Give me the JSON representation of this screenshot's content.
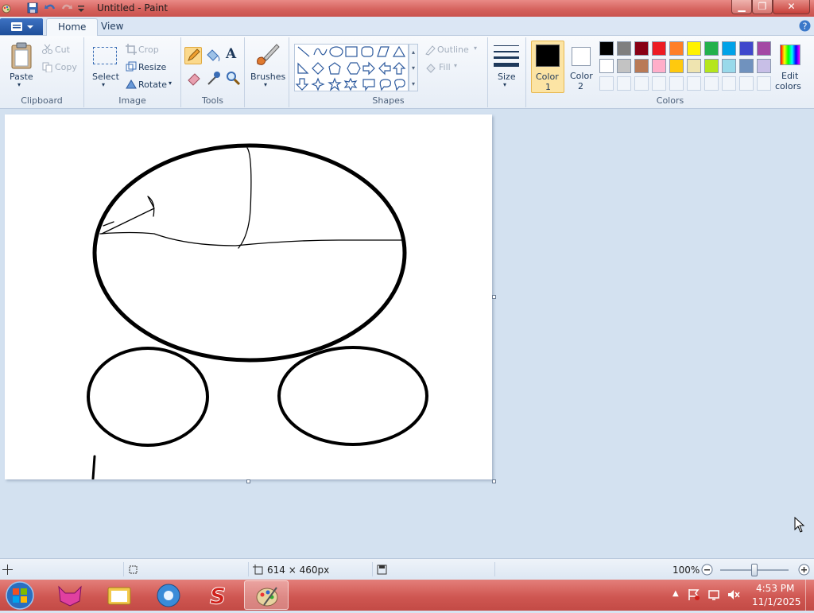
{
  "window": {
    "title": "Untitled - Paint"
  },
  "tabs": [
    {
      "label": "Home",
      "active": true
    },
    {
      "label": "View",
      "active": false
    }
  ],
  "clipboard": {
    "paste": "Paste",
    "cut": "Cut",
    "copy": "Copy",
    "group": "Clipboard"
  },
  "image": {
    "select": "Select",
    "crop": "Crop",
    "resize": "Resize",
    "rotate": "Rotate",
    "group": "Image"
  },
  "tools": {
    "group": "Tools",
    "brushes": "Brushes",
    "text_tool": "A"
  },
  "shapes": {
    "group": "Shapes",
    "outline": "Outline",
    "fill": "Fill"
  },
  "size": {
    "label": "Size"
  },
  "colors": {
    "color1_line1": "Color",
    "color1_line2": "1",
    "color2_line1": "Color",
    "color2_line2": "2",
    "edit_line1": "Edit",
    "edit_line2": "colors",
    "group": "Colors",
    "color1_value": "#000000",
    "color2_value": "#ffffff",
    "palette_row1": [
      "#000000",
      "#7f7f7f",
      "#880015",
      "#ed1c24",
      "#ff7f27",
      "#fff200",
      "#22b14c",
      "#00a2e8",
      "#3f48cc",
      "#a349a4"
    ],
    "palette_row2": [
      "#ffffff",
      "#c3c3c3",
      "#b97a57",
      "#ffaec9",
      "#ffc90e",
      "#efe4b0",
      "#b5e61d",
      "#99d9ea",
      "#7092be",
      "#c8bfe7"
    ]
  },
  "status": {
    "dimensions": "614 × 460px",
    "zoom": "100%",
    "zoom_fraction": 0.5
  },
  "taskbar": {
    "time": "4:53 PM",
    "date": "11/1/2025"
  }
}
